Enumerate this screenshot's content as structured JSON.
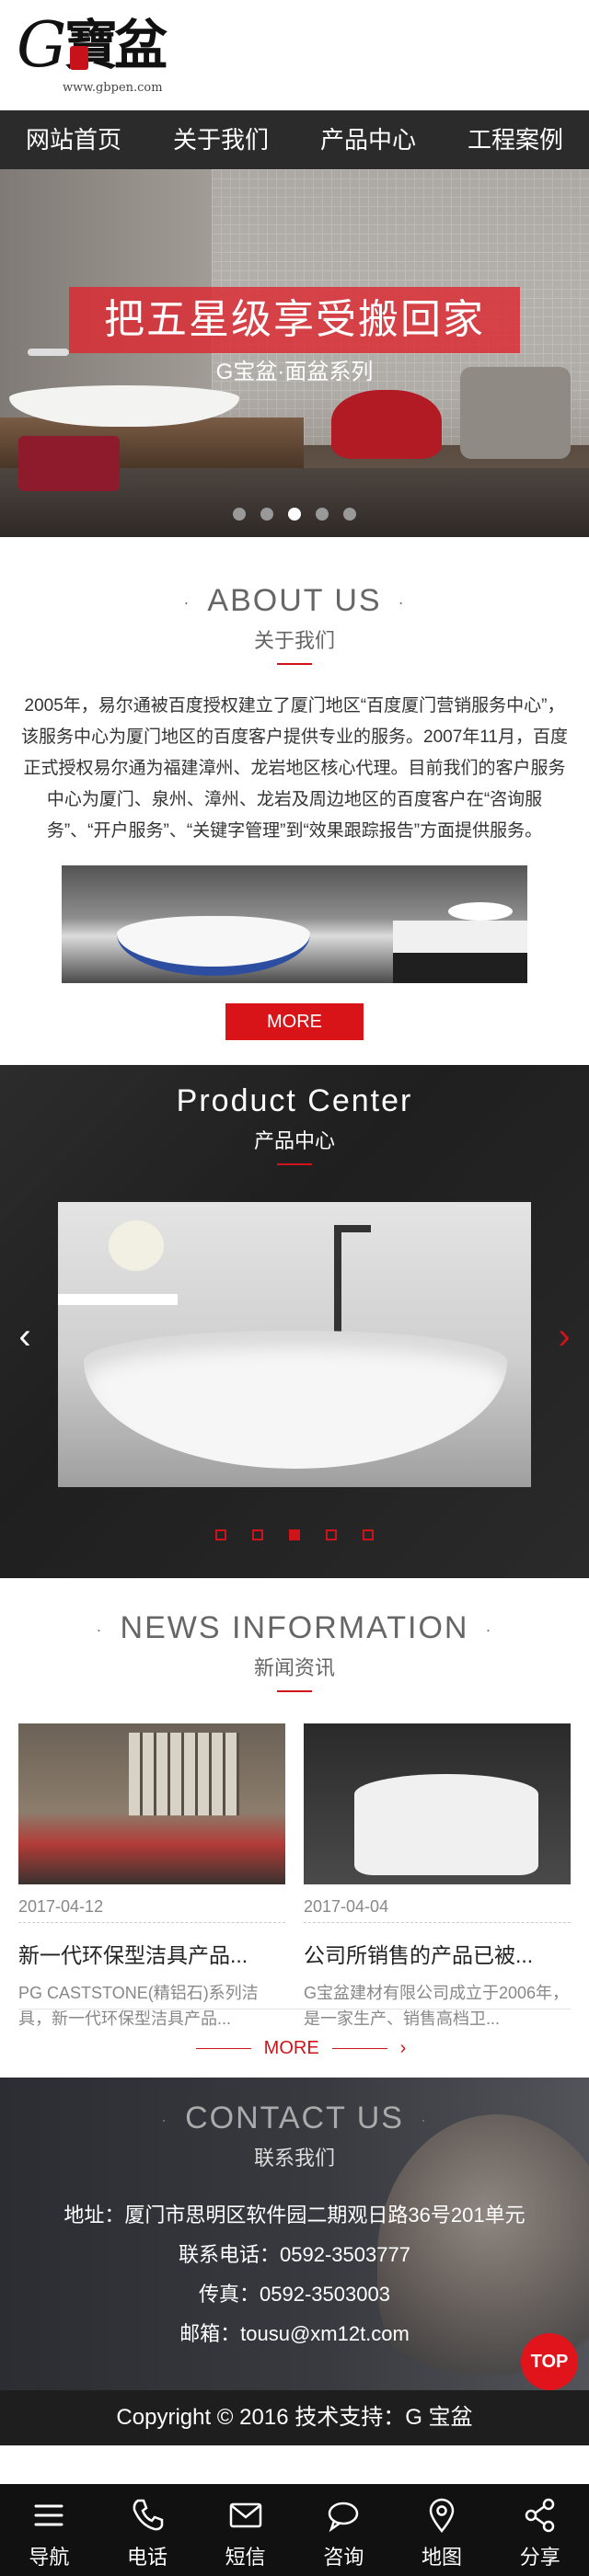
{
  "logo": {
    "mark": "G",
    "name": "寶盆",
    "url": "www.gbpen.com"
  },
  "nav": {
    "items": [
      "网站首页",
      "关于我们",
      "产品中心",
      "工程案例"
    ]
  },
  "banner": {
    "title": "把五星级享受搬回家",
    "subtitle": "G宝盆·面盆系列",
    "dots": 5,
    "active_dot": 2
  },
  "about": {
    "title_en": "ABOUT US",
    "title_cn": "关于我们",
    "text": "2005年，易尔通被百度授权建立了厦门地区“百度厦门营销服务中心”，该服务中心为厦门地区的百度客户提供专业的服务。2007年11月，百度正式授权易尔通为福建漳州、龙岩地区核心代理。目前我们的客户服务中心为厦门、泉州、漳州、龙岩及周边地区的百度客户在“咨询服务”、“开户服务”、“关键字管理”到“效果跟踪报告”方面提供服务。",
    "more": "MORE"
  },
  "product": {
    "title_en": "Product Center",
    "title_cn": "产品中心",
    "dots": 5,
    "active_dot": 2
  },
  "news": {
    "title_en": "NEWS INFORMATION",
    "title_cn": "新闻资讯",
    "items": [
      {
        "date": "2017-04-12",
        "title": "新一代环保型洁具产品...",
        "desc": "PG CASTSTONE(精铝石)系列洁具，新一代环保型洁具产品..."
      },
      {
        "date": "2017-04-04",
        "title": "公司所销售的产品已被...",
        "desc": "G宝盆建材有限公司成立于2006年，是一家生产、销售高档卫..."
      }
    ],
    "more": "MORE"
  },
  "contact": {
    "title_en": "CONTACT US",
    "title_cn": "联系我们",
    "address": "地址：厦门市思明区软件园二期观日路36号201单元",
    "phone": "联系电话：0592-3503777",
    "fax": "传真：0592-3503003",
    "email": "邮箱：tousu@xm12t.com"
  },
  "footer": {
    "copyright": "Copyright © 2016  技术支持：G 宝盆",
    "top": "TOP"
  },
  "tabbar": {
    "items": [
      {
        "label": "导航",
        "icon": "menu-icon"
      },
      {
        "label": "电话",
        "icon": "phone-icon"
      },
      {
        "label": "短信",
        "icon": "mail-icon"
      },
      {
        "label": "咨询",
        "icon": "chat-icon"
      },
      {
        "label": "地图",
        "icon": "map-pin-icon"
      },
      {
        "label": "分享",
        "icon": "share-icon"
      }
    ]
  },
  "colors": {
    "accent": "#d0131a",
    "nav_bg": "#2b2b2b",
    "tabbar_bg": "#111111"
  }
}
